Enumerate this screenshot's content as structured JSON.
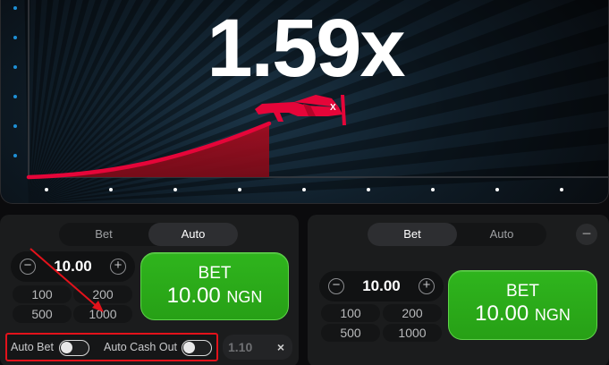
{
  "game": {
    "multiplier": "1.59x"
  },
  "left_panel": {
    "tabs": [
      {
        "label": "Bet",
        "active": false
      },
      {
        "label": "Auto",
        "active": true
      }
    ],
    "stake": "10.00",
    "quick_amounts": [
      "100",
      "200",
      "500",
      "1000"
    ],
    "bet_button": {
      "line1": "BET",
      "amount": "10.00",
      "currency": "NGN"
    },
    "auto_bet_label": "Auto Bet",
    "auto_cashout_label": "Auto Cash Out",
    "auto_bet_on": false,
    "auto_cashout_on": false,
    "auto_cashout_value": "1.10",
    "clear_symbol": "×"
  },
  "right_panel": {
    "tabs": [
      {
        "label": "Bet",
        "active": true
      },
      {
        "label": "Auto",
        "active": false
      }
    ],
    "stake": "10.00",
    "quick_amounts": [
      "100",
      "200",
      "500",
      "1000"
    ],
    "bet_button": {
      "line1": "BET",
      "amount": "10.00",
      "currency": "NGN"
    },
    "collapse_symbol": "−"
  },
  "colors": {
    "accent_green": "#28a909",
    "curve_red": "#e50539",
    "highlight_red": "#e3121b",
    "y_axis_dot": "#1e90d6"
  }
}
